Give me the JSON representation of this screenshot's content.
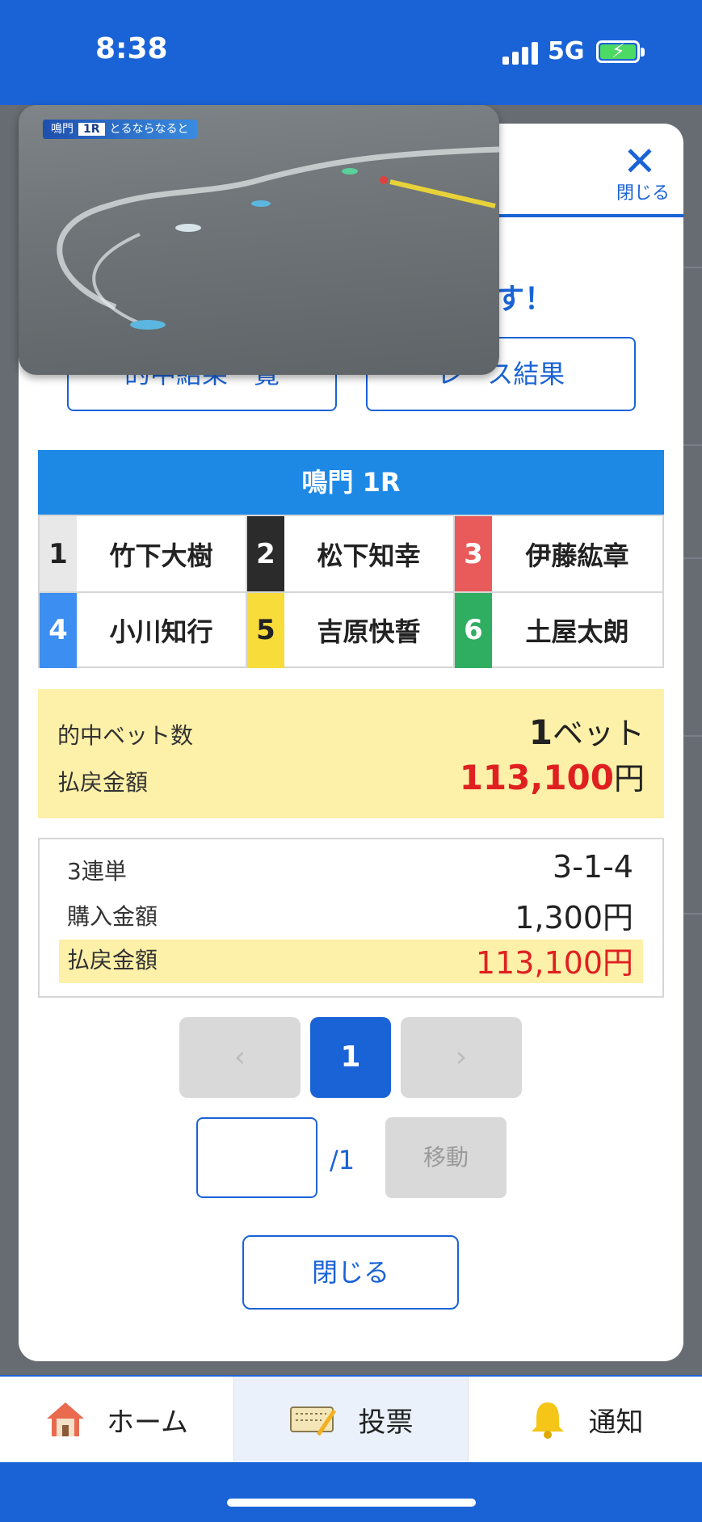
{
  "status_bar": {
    "time": "8:38",
    "network": "5G"
  },
  "modal": {
    "close_label": "閉じる",
    "heading_partial": "す！",
    "links": [
      "的中結果一覧",
      "レース結果"
    ],
    "race_title": "鳴門 1R",
    "racers": [
      {
        "num": "1",
        "name": "竹下大樹",
        "color": "#e8e8e8",
        "text_color": "#222222"
      },
      {
        "num": "2",
        "name": "松下知幸",
        "color": "#2b2b2b",
        "text_color": "#ffffff"
      },
      {
        "num": "3",
        "name": "伊藤紘章",
        "color": "#e95b5b",
        "text_color": "#ffffff"
      },
      {
        "num": "4",
        "name": "小川知行",
        "color": "#3c8ef0",
        "text_color": "#ffffff"
      },
      {
        "num": "5",
        "name": "吉原快誓",
        "color": "#f7dc3a",
        "text_color": "#222222"
      },
      {
        "num": "6",
        "name": "土屋太朗",
        "color": "#2fae62",
        "text_color": "#ffffff"
      }
    ],
    "summary": {
      "hit_bets_label": "的中ベット数",
      "hit_bets_value": "1",
      "hit_bets_unit": "ベット",
      "payout_label": "払戻金額",
      "payout_value": "113,100",
      "payout_unit": "円"
    },
    "detail": {
      "bet_type": "3連単",
      "combination": "3-1-4",
      "purchase_label": "購入金額",
      "purchase_value": "1,300円",
      "payout_label": "払戻金額",
      "payout_value": "113,100円"
    },
    "pagination": {
      "prev": "‹",
      "current": "1",
      "next": "›",
      "total": "/1",
      "move": "移動"
    },
    "close_button": "閉じる"
  },
  "video": {
    "venue": "鳴門",
    "race": "1R",
    "caption": "とるならなると"
  },
  "tabs": [
    {
      "label": "ホーム",
      "icon": "house-icon"
    },
    {
      "label": "投票",
      "icon": "ticket-pen-icon"
    },
    {
      "label": "通知",
      "icon": "bell-icon"
    }
  ],
  "colors": {
    "accent": "#1a63d6",
    "payout_red": "#e02020",
    "highlight": "#fdf0a8"
  }
}
